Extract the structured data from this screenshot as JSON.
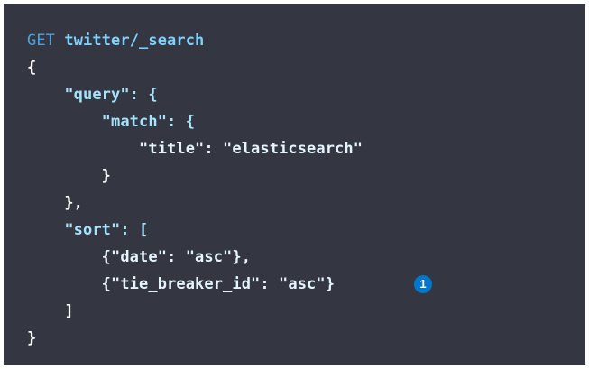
{
  "code": {
    "method": "GET",
    "path": "twitter/_search",
    "lines": [
      "{",
      "    \"query\": {",
      "        \"match\": {",
      "            \"title\": \"elasticsearch\"",
      "        }",
      "    },",
      "    \"sort\": [",
      "        {\"date\": \"asc\"},",
      "        {\"tie_breaker_id\": \"asc\"}",
      "    ]",
      "}"
    ],
    "callout_label": "1"
  },
  "colors": {
    "panel_background": "#343741",
    "method": "#4aa3df",
    "callout": "#0077cc"
  }
}
